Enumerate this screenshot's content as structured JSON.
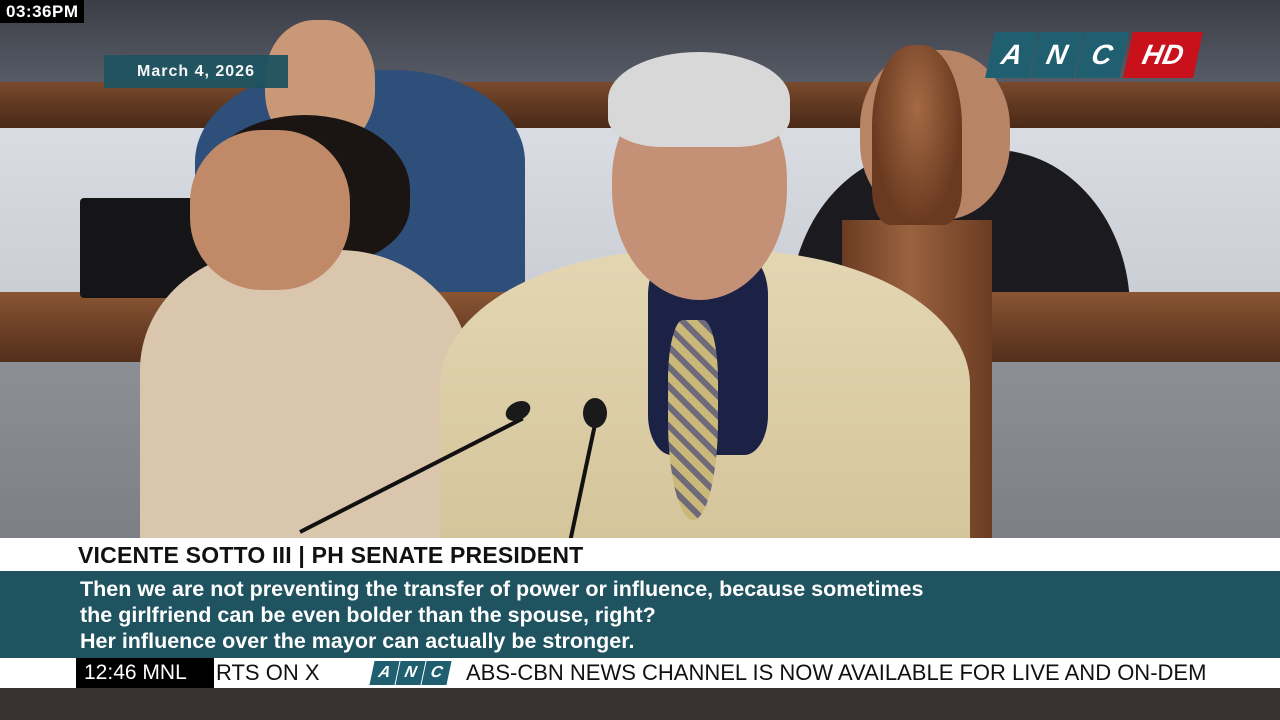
{
  "clock": "03:36PM",
  "date": "March 4, 2026",
  "channel_logo": {
    "letters": [
      "A",
      "N",
      "C"
    ],
    "hd": "HD",
    "brand_color": "#1f5f70",
    "hd_color": "#c8111b"
  },
  "lower_third": {
    "name_title": "VICENTE SOTTO III | PH SENATE PRESIDENT",
    "quote_lines": [
      "Then we are not preventing the transfer of power or influence, because sometimes",
      "the girlfriend can be even bolder than the spouse, right?",
      "Her influence over the mayor can actually be stronger."
    ],
    "accent_color": "#1f5360"
  },
  "ticker": {
    "time": "12:46",
    "zone": "MNL",
    "text_before": "RTS ON X",
    "anc_letters": [
      "A",
      "N",
      "C"
    ],
    "text_after": "ABS-CBN NEWS CHANNEL IS NOW AVAILABLE FOR LIVE AND ON-DEM"
  }
}
